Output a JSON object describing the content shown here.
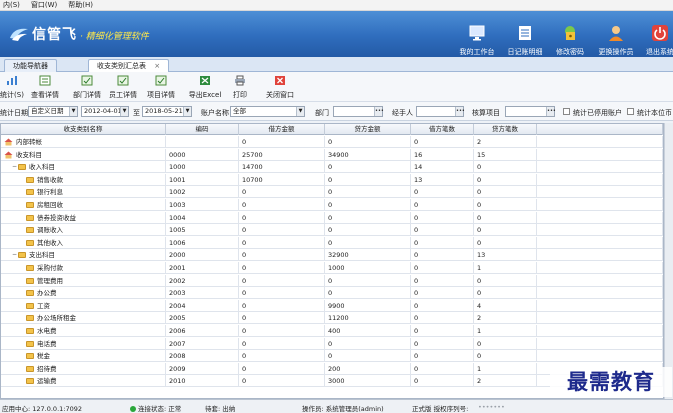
{
  "menubar": {
    "items": [
      "内(S)",
      "窗口(W)",
      "帮助(H)"
    ]
  },
  "banner": {
    "brand": "信管飞",
    "slogan": "· 精细化管理软件",
    "buttons": [
      {
        "label": "我的工作台",
        "icon": "monitor-icon"
      },
      {
        "label": "日记账明细",
        "icon": "ledger-icon"
      },
      {
        "label": "修改密码",
        "icon": "lock-icon"
      },
      {
        "label": "更换操作员",
        "icon": "user-icon"
      },
      {
        "label": "退出系统",
        "icon": "power-icon"
      }
    ]
  },
  "tabs": [
    {
      "label": "功能导航器",
      "active": false
    },
    {
      "label": "收支类别汇总表",
      "active": true,
      "close": "×"
    }
  ],
  "toolbar": {
    "items": [
      {
        "label": "统计(S)",
        "icon": "stats-icon"
      },
      {
        "label": "查看详情",
        "icon": "view-detail-icon"
      },
      {
        "label": "部门详情",
        "icon": "dept-detail-icon"
      },
      {
        "label": "员工详情",
        "icon": "staff-detail-icon"
      },
      {
        "label": "项目详情",
        "icon": "project-detail-icon"
      },
      {
        "label": "导出Excel",
        "icon": "excel-icon"
      },
      {
        "label": "打印",
        "icon": "print-icon"
      },
      {
        "label": "关闭窗口",
        "icon": "close-window-icon"
      }
    ]
  },
  "filter": {
    "date_label": "统计日期",
    "date_mode": "自定义日期",
    "date_from": "2012-04-01",
    "date_to_label": "至",
    "date_to": "2018-05-21",
    "account_label": "账户名称",
    "account_value": "全部",
    "dept_label": "部门",
    "dept_value": "",
    "handler_label": "经手人",
    "handler_value": "",
    "project_label": "核算项目",
    "project_value": "",
    "check1": "统计已停用账户",
    "check2": "统计本位币"
  },
  "grid": {
    "headers": [
      "收支类别名称",
      "编码",
      "借方金额",
      "贷方金额",
      "借方笔数",
      "贷方笔数",
      ""
    ],
    "rows": [
      {
        "level": 0,
        "type": "root",
        "name": "内部转帐",
        "code": "",
        "debit": "0",
        "credit": "0",
        "dcount": "0",
        "ccount": "2"
      },
      {
        "level": 0,
        "type": "root",
        "name": "收支科目",
        "code": "0000",
        "debit": "25700",
        "credit": "34900",
        "dcount": "16",
        "ccount": "15"
      },
      {
        "level": 1,
        "type": "folder",
        "name": "收入科目",
        "code": "1000",
        "debit": "14700",
        "credit": "0",
        "dcount": "14",
        "ccount": "0"
      },
      {
        "level": 2,
        "type": "leaf",
        "name": "销售收款",
        "code": "1001",
        "debit": "10700",
        "credit": "0",
        "dcount": "13",
        "ccount": "0"
      },
      {
        "level": 2,
        "type": "leaf",
        "name": "银行利息",
        "code": "1002",
        "debit": "0",
        "credit": "0",
        "dcount": "0",
        "ccount": "0"
      },
      {
        "level": 2,
        "type": "leaf",
        "name": "房租回收",
        "code": "1003",
        "debit": "0",
        "credit": "0",
        "dcount": "0",
        "ccount": "0"
      },
      {
        "level": 2,
        "type": "leaf",
        "name": "债券投资收益",
        "code": "1004",
        "debit": "0",
        "credit": "0",
        "dcount": "0",
        "ccount": "0"
      },
      {
        "level": 2,
        "type": "leaf",
        "name": "调账收入",
        "code": "1005",
        "debit": "0",
        "credit": "0",
        "dcount": "0",
        "ccount": "0"
      },
      {
        "level": 2,
        "type": "leaf",
        "name": "其他收入",
        "code": "1006",
        "debit": "0",
        "credit": "0",
        "dcount": "0",
        "ccount": "0"
      },
      {
        "level": 1,
        "type": "folder",
        "name": "支出科目",
        "code": "2000",
        "debit": "0",
        "credit": "32900",
        "dcount": "0",
        "ccount": "13"
      },
      {
        "level": 2,
        "type": "leaf",
        "name": "采购付款",
        "code": "2001",
        "debit": "0",
        "credit": "1000",
        "dcount": "0",
        "ccount": "1"
      },
      {
        "level": 2,
        "type": "leaf",
        "name": "管理费用",
        "code": "2002",
        "debit": "0",
        "credit": "0",
        "dcount": "0",
        "ccount": "0"
      },
      {
        "level": 2,
        "type": "leaf",
        "name": "办公费",
        "code": "2003",
        "debit": "0",
        "credit": "0",
        "dcount": "0",
        "ccount": "0"
      },
      {
        "level": 2,
        "type": "leaf",
        "name": "工资",
        "code": "2004",
        "debit": "0",
        "credit": "9900",
        "dcount": "0",
        "ccount": "4"
      },
      {
        "level": 2,
        "type": "leaf",
        "name": "办公场所租金",
        "code": "2005",
        "debit": "0",
        "credit": "11200",
        "dcount": "0",
        "ccount": "2"
      },
      {
        "level": 2,
        "type": "leaf",
        "name": "水电费",
        "code": "2006",
        "debit": "0",
        "credit": "400",
        "dcount": "0",
        "ccount": "1"
      },
      {
        "level": 2,
        "type": "leaf",
        "name": "电话费",
        "code": "2007",
        "debit": "0",
        "credit": "0",
        "dcount": "0",
        "ccount": "0"
      },
      {
        "level": 2,
        "type": "leaf",
        "name": "税金",
        "code": "2008",
        "debit": "0",
        "credit": "0",
        "dcount": "0",
        "ccount": "0"
      },
      {
        "level": 2,
        "type": "leaf",
        "name": "招待费",
        "code": "2009",
        "debit": "0",
        "credit": "200",
        "dcount": "0",
        "ccount": "1"
      },
      {
        "level": 2,
        "type": "leaf",
        "name": "运输费",
        "code": "2010",
        "debit": "0",
        "credit": "3000",
        "dcount": "0",
        "ccount": "2"
      }
    ]
  },
  "status": {
    "server": "应用中心: 127.0.0.1:7092",
    "conn": "连接状态: 正常",
    "status": "待套: 出纳",
    "operator": "操作员: 系统管理员(admin)",
    "license": "正式版 授权序列号:",
    "serial": "•••••••"
  },
  "watermark": "最需教育",
  "colors": {
    "banner": "#2f6dbd",
    "slogan": "#ffe94a",
    "folder": "#f3c34a"
  }
}
